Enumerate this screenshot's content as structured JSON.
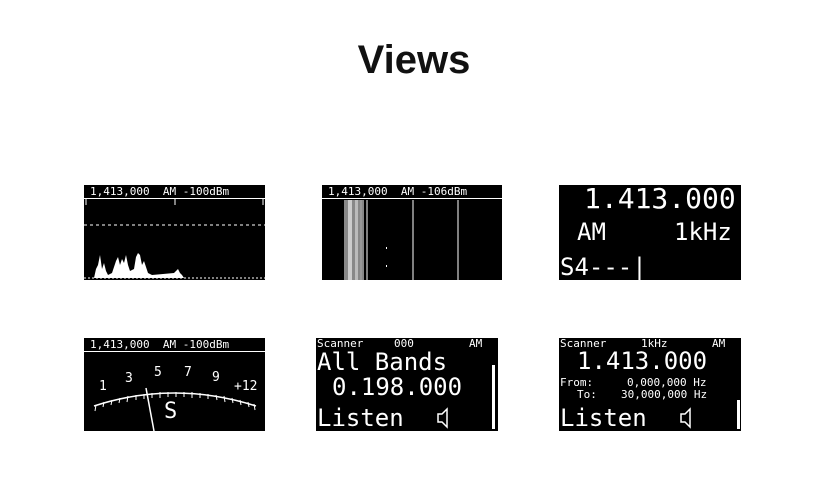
{
  "page": {
    "title": "Views"
  },
  "views": {
    "spectrum": {
      "header": "1,413,000  AM -100dBm"
    },
    "waterfall": {
      "header": "1,413,000  AM -106dBm"
    },
    "big_freq": {
      "frequency": "1.413.000",
      "mode": "AM",
      "step": "1kHz",
      "smeter": "S4---|"
    },
    "smeter": {
      "header": "1,413,000  AM -100dBm",
      "scale_labels": [
        "1",
        "3",
        "5",
        "7",
        "9",
        "+12"
      ],
      "unit": "S"
    },
    "scanner_bands": {
      "label": "Scanner",
      "channel": "000",
      "mode": "AM",
      "title": "All Bands",
      "frequency": "0.198.000",
      "action": "Listen",
      "speaker_icon": "speaker-icon"
    },
    "scanner_range": {
      "label": "Scanner",
      "step": "1kHz",
      "mode": "AM",
      "frequency": "1.413.000",
      "from_label": "From:",
      "from_value": "0,000,000 Hz",
      "to_label": "To:",
      "to_value": "30,000,000 Hz",
      "action": "Listen",
      "speaker_icon": "speaker-icon"
    }
  }
}
